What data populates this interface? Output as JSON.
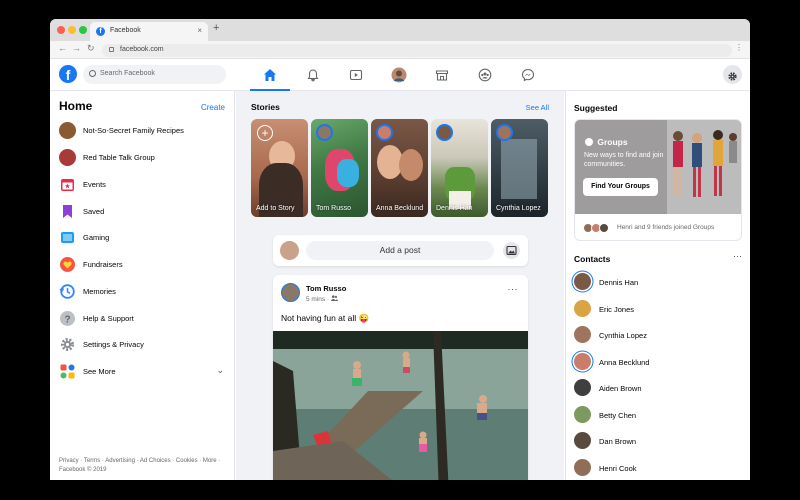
{
  "browser": {
    "tab_title": "Facebook",
    "new_tab": "+",
    "tab_close": "×",
    "url": "facebook.com",
    "back": "←",
    "forward": "→",
    "reload": "↻",
    "menu": "⋮"
  },
  "header": {
    "logo": "f",
    "search_placeholder": "Search Facebook"
  },
  "left": {
    "title": "Home",
    "create": "Create",
    "items": [
      {
        "label": "Not-So-Secret Family Recipes",
        "color": "#8a5a33"
      },
      {
        "label": "Red Table Talk Group",
        "color": "#a83a3a"
      },
      {
        "label": "Events",
        "color": "#f02849"
      },
      {
        "label": "Saved",
        "color": "#8c3fdb"
      },
      {
        "label": "Gaming",
        "color": "#1b9df0"
      },
      {
        "label": "Fundraisers",
        "color": "#f7533e"
      },
      {
        "label": "Memories",
        "color": "#2d88ff"
      },
      {
        "label": "Help & Support",
        "color": "#8a8d91"
      },
      {
        "label": "Settings & Privacy",
        "color": "#65676b"
      },
      {
        "label": "See More",
        "color": "#45bd62"
      }
    ],
    "see_more_chevron": "⌄",
    "footer": "Privacy · Terms · Advertising · Ad Choices · Cookies · More · Facebook © 2019"
  },
  "middle": {
    "stories_title": "Stories",
    "see_all": "See All",
    "stories": [
      {
        "name": "Add to Story",
        "bg": "#b97a5e"
      },
      {
        "name": "Tom Russo",
        "bg": "#4a8c4e"
      },
      {
        "name": "Anna Becklund",
        "bg": "#6a4b3e"
      },
      {
        "name": "Dennis Han",
        "bg": "#7a8f6a"
      },
      {
        "name": "Cynthia Lopez",
        "bg": "#3b4a55"
      }
    ],
    "composer_placeholder": "Add a post",
    "post": {
      "author": "Tom Russo",
      "time": "5 mins · ",
      "text": "Not having fun at all 😜",
      "more": "···"
    }
  },
  "right": {
    "suggested_title": "Suggested",
    "groups_heading": "Groups",
    "groups_sub": "New ways to find and join communities.",
    "groups_button": "Find Your Groups",
    "groups_foot": "Henri and 9 friends joined Groups",
    "contacts_title": "Contacts",
    "contacts_more": "···",
    "contacts": [
      {
        "name": "Dennis Han",
        "color": "#7b5a45",
        "ring": true
      },
      {
        "name": "Eric Jones",
        "color": "#d9a441",
        "ring": false
      },
      {
        "name": "Cynthia Lopez",
        "color": "#a0735e",
        "ring": false
      },
      {
        "name": "Anna Becklund",
        "color": "#c97d6a",
        "ring": true
      },
      {
        "name": "Aiden Brown",
        "color": "#3f3f3f",
        "ring": false
      },
      {
        "name": "Betty Chen",
        "color": "#7c9a5d",
        "ring": false
      },
      {
        "name": "Dan Brown",
        "color": "#5a4a3c",
        "ring": false
      },
      {
        "name": "Henri Cook",
        "color": "#8f6d57",
        "ring": false
      }
    ]
  },
  "colors": {
    "brand": "#1877f2",
    "background": "#f0f2f5"
  }
}
